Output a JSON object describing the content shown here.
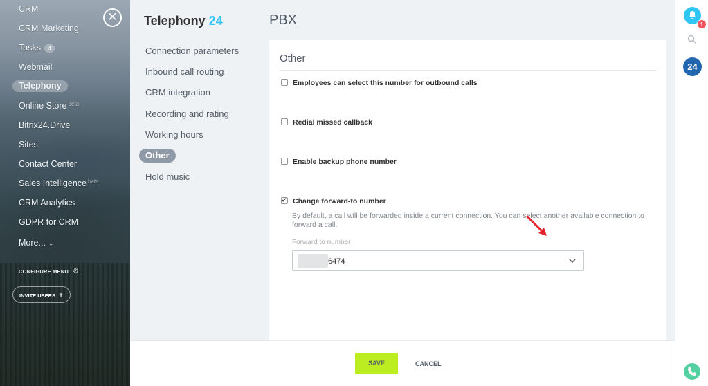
{
  "left_nav": {
    "items": [
      {
        "label": "CRM"
      },
      {
        "label": "CRM Marketing"
      },
      {
        "label": "Tasks",
        "badge": "4"
      },
      {
        "label": "Webmail"
      },
      {
        "label": "Telephony",
        "active": true
      },
      {
        "label": "Online Store",
        "sup": "beta"
      },
      {
        "label": "Bitrix24.Drive"
      },
      {
        "label": "Sites"
      },
      {
        "label": "Contact Center"
      },
      {
        "label": "Sales Intelligence",
        "sup": "beta"
      },
      {
        "label": "CRM Analytics"
      },
      {
        "label": "GDPR for CRM"
      },
      {
        "label": "More..."
      }
    ],
    "configure_menu": "CONFIGURE MENU",
    "invite_users": "INVITE USERS"
  },
  "slider": {
    "app_title": "Telephony",
    "app_title_accent": "24",
    "page_title": "PBX",
    "settings_nav": [
      {
        "label": "Connection parameters"
      },
      {
        "label": "Inbound call routing"
      },
      {
        "label": "CRM integration"
      },
      {
        "label": "Recording and rating"
      },
      {
        "label": "Working hours"
      },
      {
        "label": "Other",
        "active": true
      },
      {
        "label": "Hold music"
      }
    ],
    "panel": {
      "heading": "Other",
      "options": [
        {
          "label": "Employees can select this number for outbound calls",
          "checked": false
        },
        {
          "label": "Redial missed callback",
          "checked": false
        },
        {
          "label": "Enable backup phone number",
          "checked": false
        },
        {
          "label": "Change forward-to number",
          "checked": true
        }
      ],
      "forward_description": "By default, a call will be forwarded inside a current connection. You can select another available connection to forward a call.",
      "forward_label": "Forward to number",
      "forward_value": "6474"
    },
    "footer": {
      "save_label": "SAVE",
      "cancel_label": "CANCEL"
    }
  },
  "right_rail": {
    "notification_count": "1",
    "b24_label": "24"
  },
  "colors": {
    "accent": "#2fc6f6",
    "save_button": "#bbed21",
    "active_nav": "#8f9aa6",
    "notification_badge": "#f2545b",
    "annotation_arrow": "#e8232d"
  }
}
